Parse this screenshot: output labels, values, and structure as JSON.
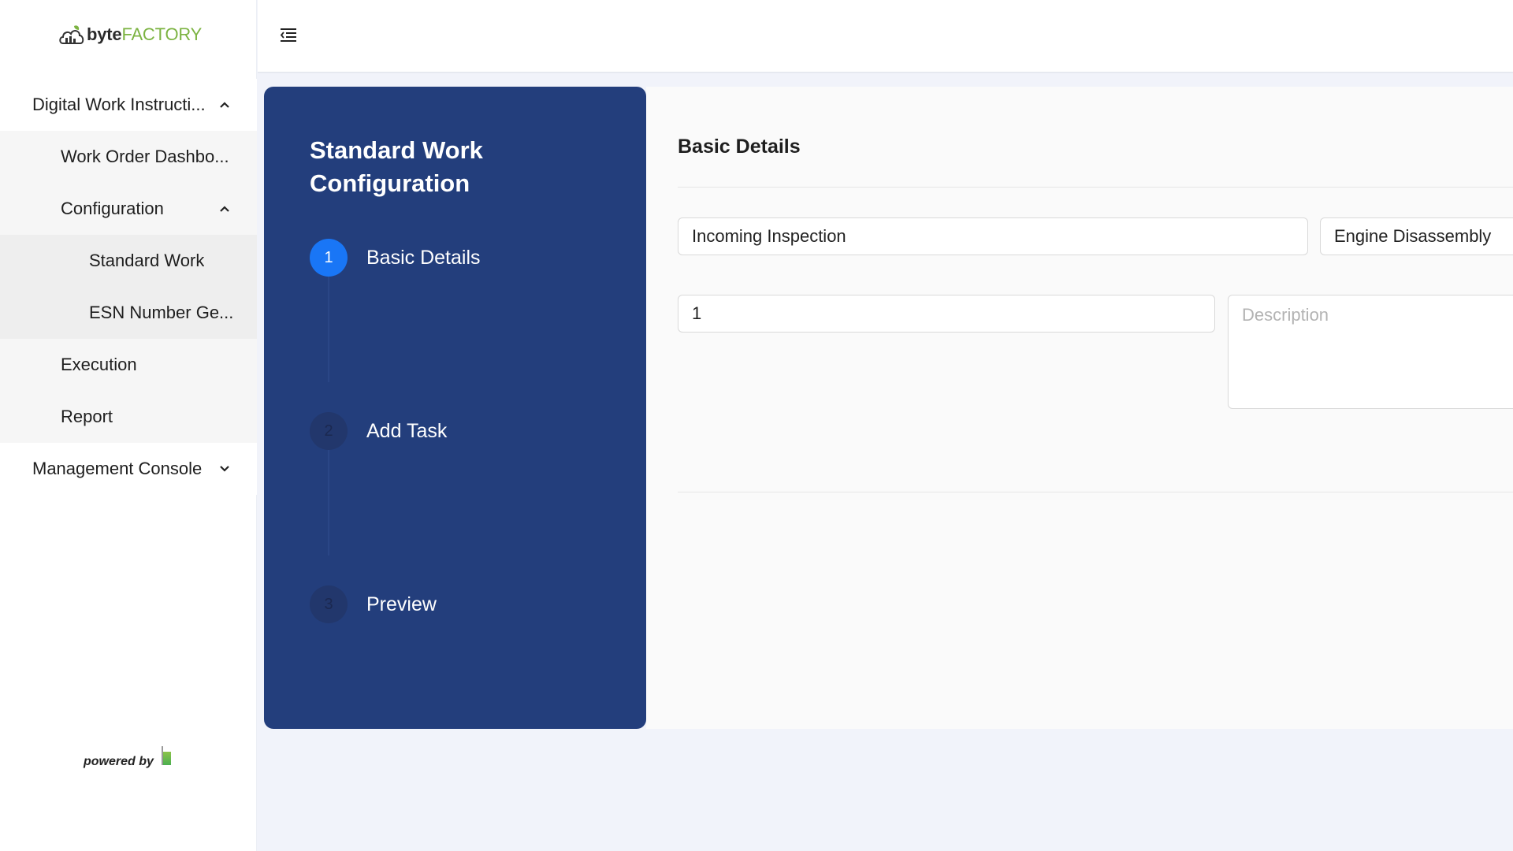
{
  "brand": {
    "name_bold": "byte",
    "name_light": "FACTORY",
    "logo_icon": "cloud-factory-icon",
    "accent_green": "#7cb342"
  },
  "sidebar": {
    "items": [
      {
        "label": "Digital Work Instructi...",
        "icon": "chevron-up-icon"
      },
      {
        "label": "Work Order Dashbo..."
      },
      {
        "label": "Configuration",
        "icon": "chevron-up-icon"
      },
      {
        "label": "Standard Work"
      },
      {
        "label": "ESN Number Ge..."
      },
      {
        "label": "Execution"
      },
      {
        "label": "Report"
      },
      {
        "label": "Management Console",
        "icon": "chevron-down-icon"
      }
    ],
    "powered_by": "powered by"
  },
  "topbar": {
    "menu_icon": "menu-collapse-icon"
  },
  "stepper": {
    "title": "Standard Work Configuration",
    "background": "#233e7c",
    "active_color": "#1976f6",
    "steps": [
      {
        "number": "1",
        "label": "Basic Details",
        "active": true
      },
      {
        "number": "2",
        "label": "Add Task",
        "active": false
      },
      {
        "number": "3",
        "label": "Preview",
        "active": false
      }
    ]
  },
  "form": {
    "section_title": "Basic Details",
    "fields": {
      "name_value": "Incoming Inspection",
      "category_value": "Engine Disassembly",
      "sequence_value": "1",
      "description_placeholder": "Description"
    }
  }
}
